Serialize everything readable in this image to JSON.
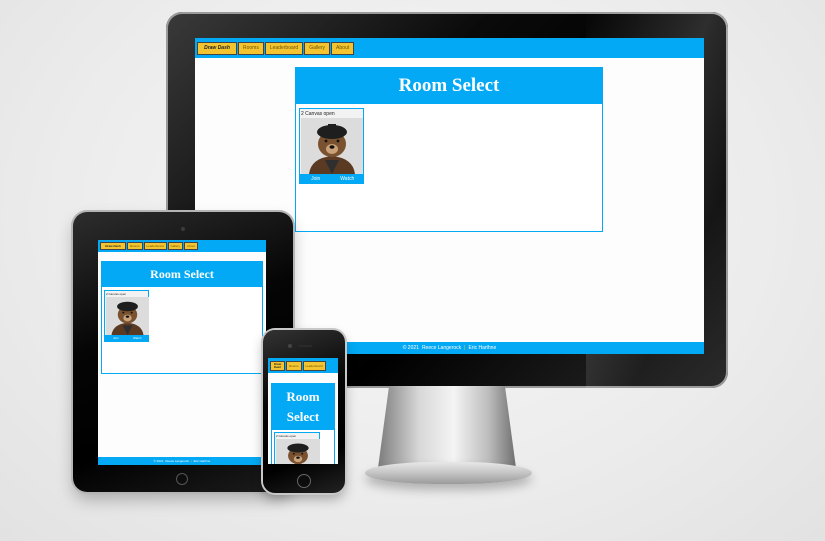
{
  "nav": {
    "brand": "Draw Dash",
    "items": [
      "Rooms",
      "Leaderboard",
      "Gallery",
      "About"
    ]
  },
  "panel": {
    "title": "Room Select"
  },
  "room_card": {
    "label": "2 Canvas open",
    "join_label": "Join",
    "watch_label": "Watch",
    "image": "bear-portrait"
  },
  "footer": {
    "copyright": "© 2021",
    "author1": "Reece Langerock",
    "separator": "|",
    "author2": "Eric Harthne"
  },
  "colors": {
    "primary": "#03a9f4",
    "accent": "#f4c430",
    "screen_bg": "#fdfdfd"
  }
}
